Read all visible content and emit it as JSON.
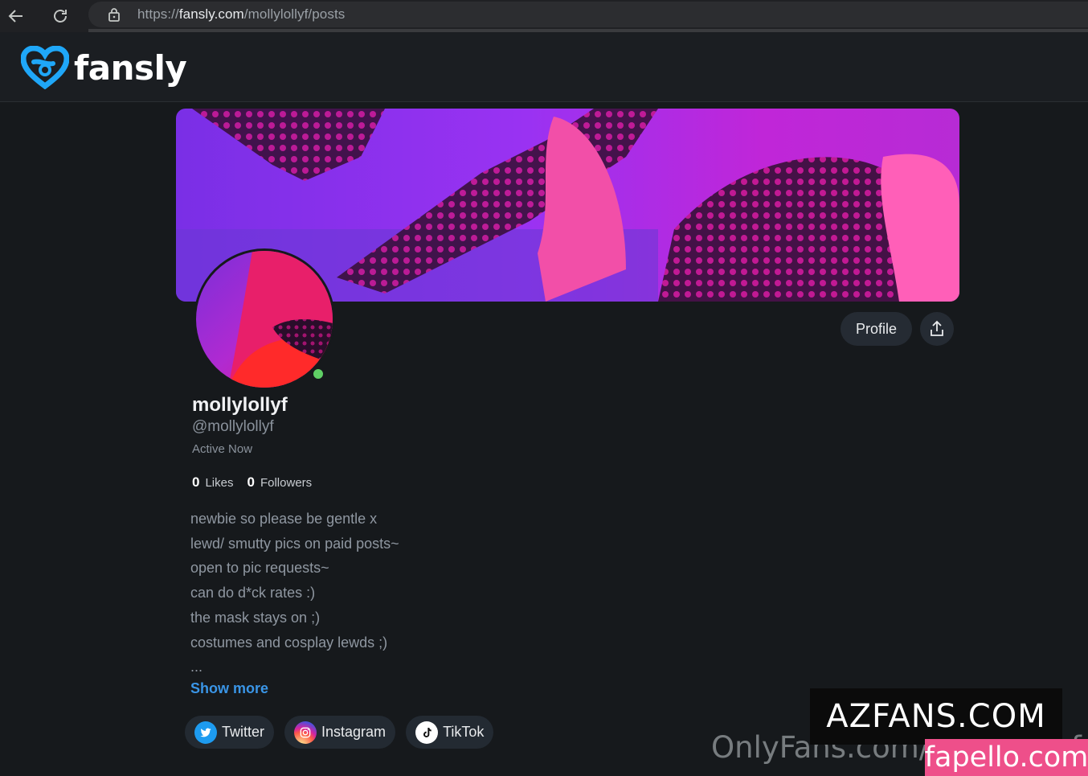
{
  "browser": {
    "url_scheme": "https://",
    "url_host": "fansly.com",
    "url_path": "/mollylollyf/posts"
  },
  "site": {
    "logo_text": "fansly",
    "brand_color": "#1fa7f8"
  },
  "profile": {
    "display_name": "mollylollyf",
    "handle": "@mollylollyf",
    "status": "Active Now",
    "likes_count": "0",
    "likes_label": "Likes",
    "followers_count": "0",
    "followers_label": "Followers",
    "bio": [
      "newbie so please be gentle x",
      "lewd/ smutty pics on paid posts~",
      "open to pic requests~",
      "can do d*ck rates :)",
      "the mask stays on ;)",
      "costumes and cosplay lewds ;)",
      "..."
    ],
    "show_more_label": "Show more",
    "online_color": "#5fcf65"
  },
  "actions": {
    "profile_button": "Profile",
    "share_icon": "share-icon"
  },
  "socials": [
    {
      "label": "Twitter",
      "icon": "twitter-icon"
    },
    {
      "label": "Instagram",
      "icon": "instagram-icon"
    },
    {
      "label": "TikTok",
      "icon": "tiktok-icon"
    }
  ],
  "watermarks": {
    "onlyfans": "OnlyFans.com/mollylollyf",
    "azfans": "AZFANS.COM",
    "fapello": "fapello.com"
  }
}
